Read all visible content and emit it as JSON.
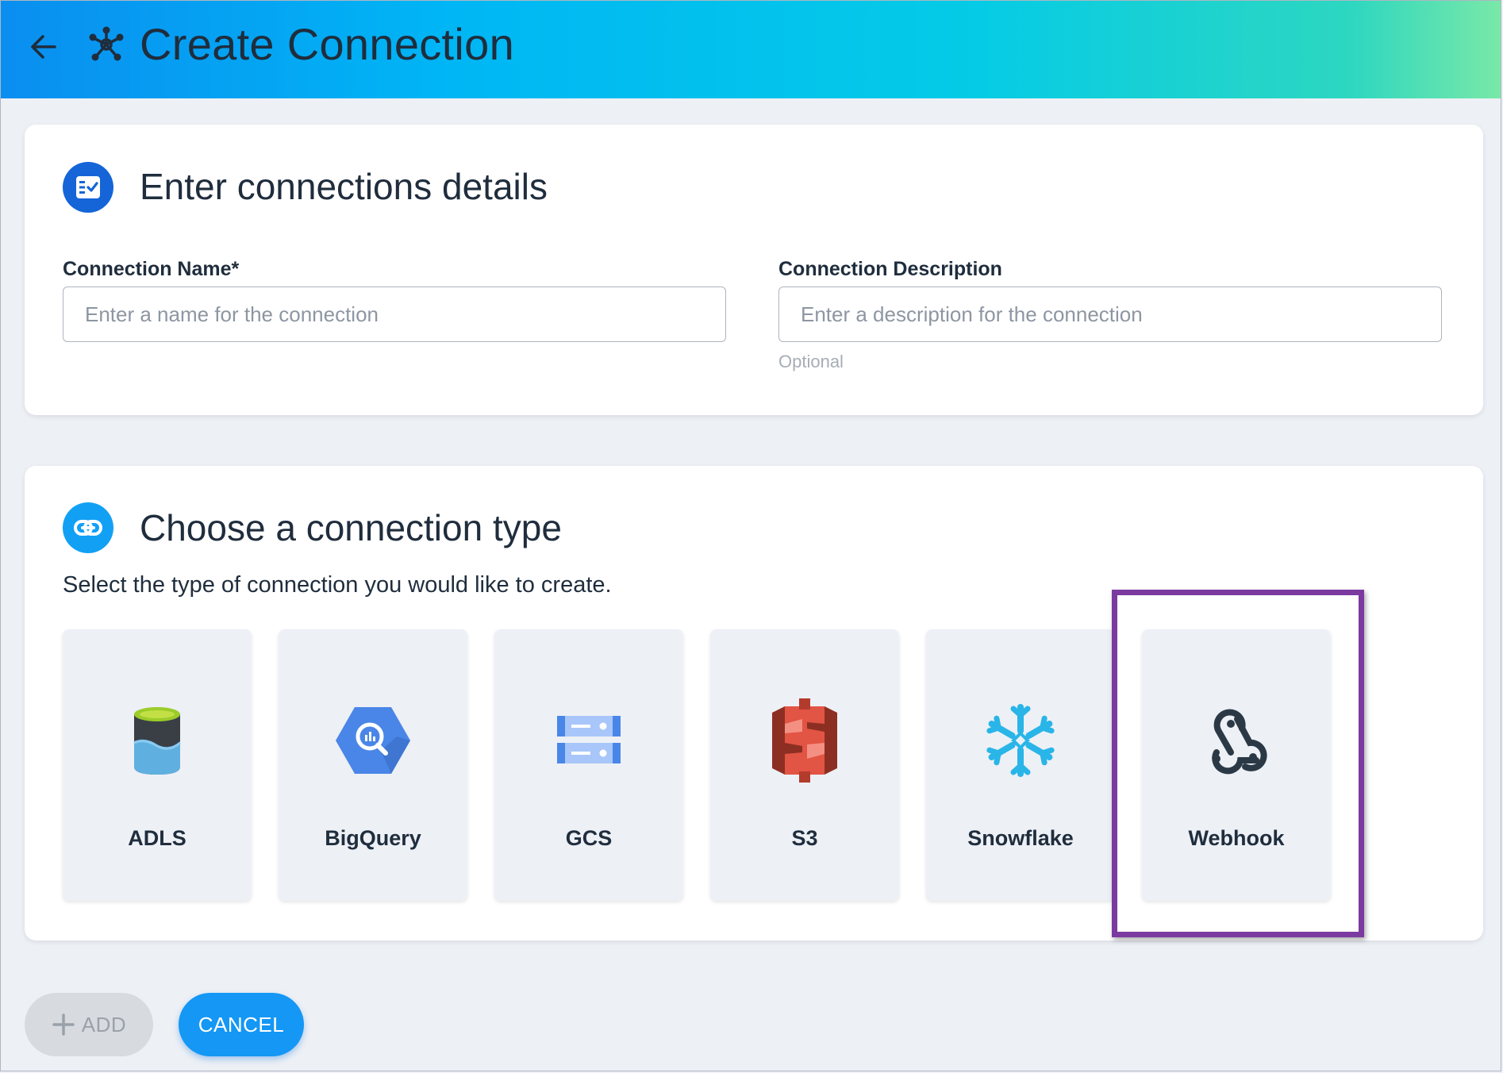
{
  "header": {
    "title": "Create Connection",
    "back_icon": "arrow-left-icon",
    "hub_icon": "network-hub-icon"
  },
  "details": {
    "title": "Enter connections details",
    "icon": "form-check-icon",
    "name_field": {
      "label": "Connection Name*",
      "placeholder": "Enter a name for the connection",
      "value": ""
    },
    "description_field": {
      "label": "Connection Description",
      "placeholder": "Enter a description for the connection",
      "value": "",
      "helper": "Optional"
    }
  },
  "type_section": {
    "title": "Choose a connection type",
    "icon": "link-icon",
    "subtitle": "Select the type of connection you would like to create.",
    "types": [
      {
        "label": "ADLS",
        "icon": "adls-icon"
      },
      {
        "label": "BigQuery",
        "icon": "bigquery-icon"
      },
      {
        "label": "GCS",
        "icon": "gcs-icon"
      },
      {
        "label": "S3",
        "icon": "s3-icon"
      },
      {
        "label": "Snowflake",
        "icon": "snowflake-icon"
      },
      {
        "label": "Webhook",
        "icon": "webhook-icon"
      }
    ],
    "highlighted": "Webhook"
  },
  "actions": {
    "add_label": "ADD",
    "add_icon": "plus-icon",
    "cancel_label": "CANCEL"
  },
  "colors": {
    "primary": "#1497f5",
    "highlight_border": "#7b3aa0",
    "text": "#1f2d3d"
  }
}
